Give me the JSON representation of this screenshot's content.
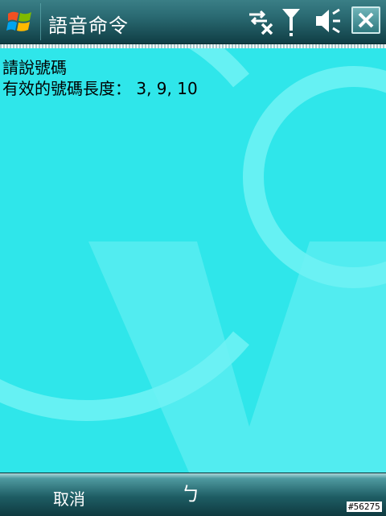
{
  "titlebar": {
    "title": "語音命令",
    "icons": [
      "windows-start-icon",
      "connectivity-icon",
      "signal-antenna-icon",
      "speaker-mute-icon",
      "close-icon"
    ]
  },
  "content": {
    "prompt": "請說號碼",
    "valid_lengths": "有效的號碼長度： 3, 9, 10"
  },
  "softkeys": {
    "left": "取消",
    "center_glyph": "ㄅ"
  },
  "corner_tag": "#56275",
  "colors": {
    "background": "#2fe6ea",
    "titlebar": "#2a6a72",
    "softbar": "#1e5d64"
  }
}
